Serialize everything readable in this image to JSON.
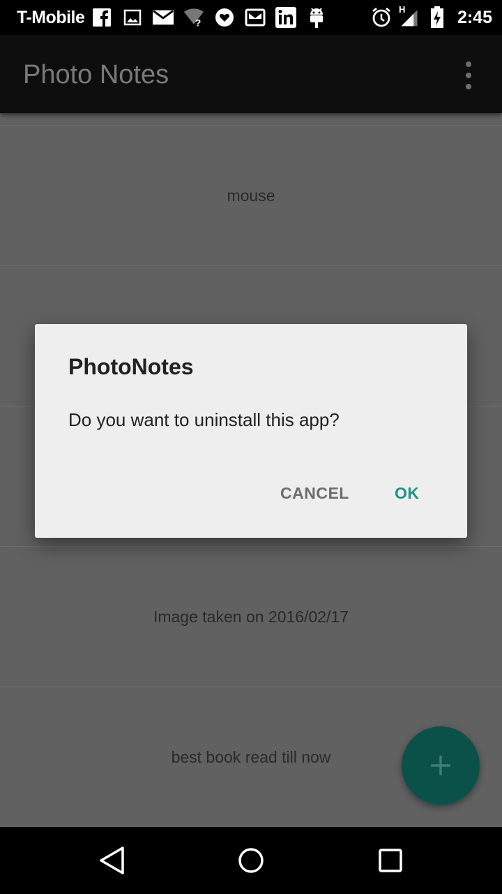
{
  "status_bar": {
    "carrier": "T-Mobile",
    "notifications": [
      "facebook-icon",
      "image-icon",
      "gmail-icon",
      "wifi-icon",
      "heart-icon",
      "inbox-icon",
      "linkedin-icon",
      "android-icon"
    ],
    "network": "H",
    "time": "2:45"
  },
  "app_bar": {
    "title": "Photo Notes"
  },
  "notes": [
    {
      "caption": "mouse"
    },
    {
      "caption": ""
    },
    {
      "caption": ""
    },
    {
      "caption": "Image taken on 2016/02/17"
    },
    {
      "caption": "best book read till now"
    }
  ],
  "dialog": {
    "title": "PhotoNotes",
    "message": "Do you want to uninstall this app?",
    "cancel_label": "CANCEL",
    "ok_label": "OK"
  },
  "colors": {
    "accent": "#1e9286",
    "fab": "#0a5249"
  }
}
